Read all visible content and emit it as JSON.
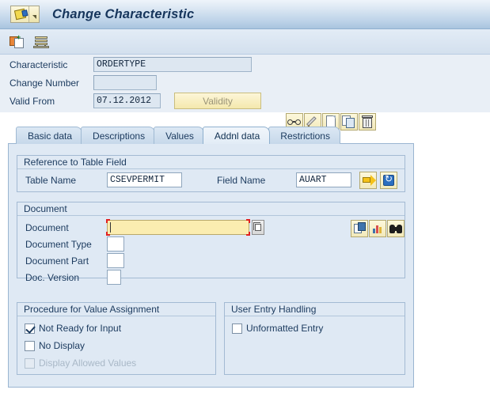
{
  "window": {
    "title": "Change Characteristic",
    "app_icon": "characteristic-tag-icon",
    "dropdown_icon": "triangle-down-icon"
  },
  "toolbar": {
    "buttons": [
      {
        "name": "copy-new-icon",
        "tooltip": "Create"
      },
      {
        "name": "stack-icon",
        "tooltip": "Layers"
      }
    ]
  },
  "header": {
    "fields": [
      {
        "label": "Characteristic",
        "value": "ORDERTYPE"
      },
      {
        "label": "Change Number",
        "value": ""
      },
      {
        "label": "Valid From",
        "value": "07.12.2012"
      }
    ],
    "validity_button": "Validity",
    "action_icons": [
      {
        "name": "glasses-icon",
        "tooltip": "Display"
      },
      {
        "name": "pencil-icon",
        "tooltip": "Change"
      },
      {
        "name": "blank-page-icon",
        "tooltip": "Create"
      },
      {
        "name": "copy-icon",
        "tooltip": "Copy"
      },
      {
        "name": "trash-icon",
        "tooltip": "Delete"
      }
    ]
  },
  "tabs": [
    {
      "label": "Basic data",
      "active": false
    },
    {
      "label": "Descriptions",
      "active": false
    },
    {
      "label": "Values",
      "active": false
    },
    {
      "label": "Addnl data",
      "active": true
    },
    {
      "label": "Restrictions",
      "active": false
    }
  ],
  "reference_group": {
    "title": "Reference to Table Field",
    "table_name_label": "Table Name",
    "table_name_value": "CSEVPERMIT",
    "field_name_label": "Field Name",
    "field_name_value": "AUART",
    "buttons": [
      {
        "name": "yellow-arrow-icon",
        "tooltip": "Continue"
      },
      {
        "name": "refresh-icon",
        "tooltip": "Refresh"
      }
    ]
  },
  "document_group": {
    "title": "Document",
    "rows": [
      {
        "label": "Document",
        "value": ""
      },
      {
        "label": "Document Type",
        "value": ""
      },
      {
        "label": "Document Part",
        "value": ""
      },
      {
        "label": "Doc. Version",
        "value": ""
      }
    ],
    "matchcode_icon": "matchcode-icon",
    "buttons": [
      {
        "name": "document-overview-icon",
        "tooltip": "Document"
      },
      {
        "name": "chart-icon",
        "tooltip": "Structure"
      },
      {
        "name": "binoculars-icon",
        "tooltip": "Find"
      }
    ]
  },
  "procedure_group": {
    "title": "Procedure for Value Assignment",
    "checkboxes": [
      {
        "label": "Not Ready for Input",
        "checked": true,
        "disabled": false
      },
      {
        "label": "No Display",
        "checked": false,
        "disabled": false
      },
      {
        "label": "Display Allowed Values",
        "checked": false,
        "disabled": true
      }
    ]
  },
  "user_entry_group": {
    "title": "User Entry Handling",
    "checkboxes": [
      {
        "label": "Unformatted Entry",
        "checked": false,
        "disabled": false
      }
    ]
  },
  "colors": {
    "titlebar_gradient_top": "#eef4fa",
    "titlebar_gradient_bottom": "#a9c4de",
    "panel_bg": "#dfe9f4",
    "field_bg": "#dde7f1",
    "focus_field_bg": "#fbedb0",
    "focus_marker": "#e02020",
    "text": "#1b3a5e"
  }
}
